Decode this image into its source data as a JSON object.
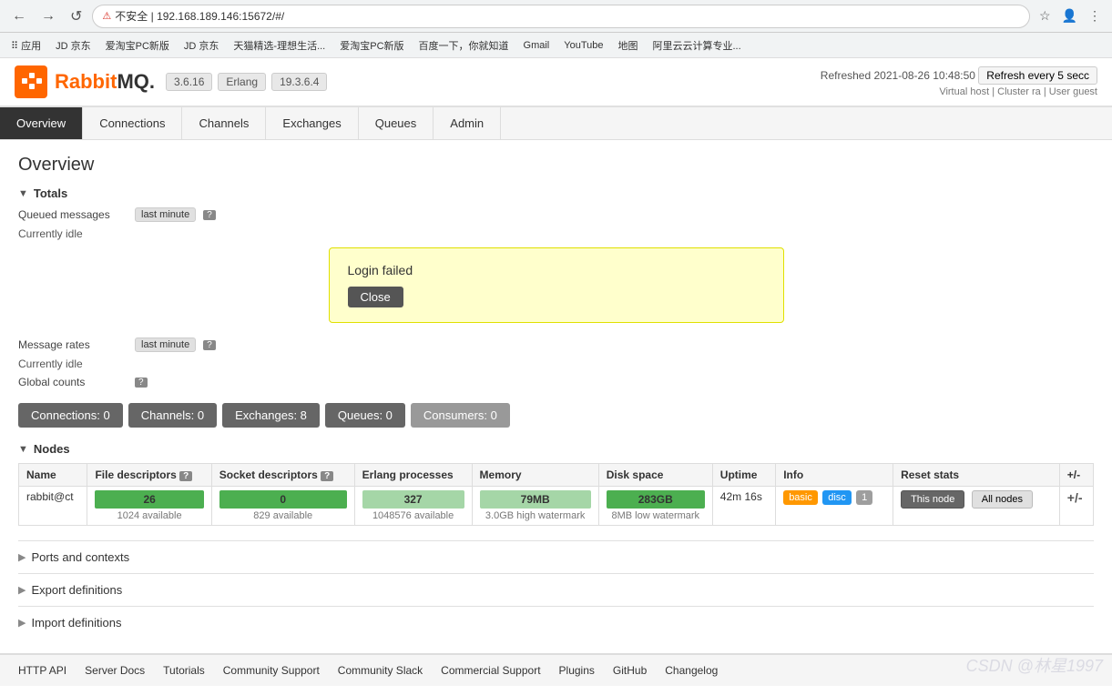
{
  "browser": {
    "back_btn": "←",
    "forward_btn": "→",
    "reload_btn": "↺",
    "address": "192.168.189.146:15672/#/",
    "address_full": "不安全 | 192.168.189.146:15672/#/",
    "lock_icon": "⚠",
    "bookmarks": [
      "应用",
      "JD 京东",
      "爱淘宝PC新版",
      "JD 京东",
      "天猫精选-理想生活...",
      "爱淘宝PC新版",
      "百度一下，你就知道",
      "Gmail",
      "YouTube",
      "地图",
      "阿里云云计算专业..."
    ]
  },
  "rmq": {
    "logo_text": "RabbitMQ",
    "version": "3.6.16",
    "erlang_label": "Erlang",
    "erlang_version": "19.3.6.4",
    "refreshed_label": "Refreshed",
    "refreshed_time": "2021-08-26 10:48:50",
    "refresh_btn_label": "Refresh every 5 secc",
    "virtual_host_label": "Virtual host",
    "cluster_label": "Cluster ra",
    "user_label": "User guest"
  },
  "nav": {
    "items": [
      {
        "id": "overview",
        "label": "Overview",
        "active": true
      },
      {
        "id": "connections",
        "label": "Connections",
        "active": false
      },
      {
        "id": "channels",
        "label": "Channels",
        "active": false
      },
      {
        "id": "exchanges",
        "label": "Exchanges",
        "active": false
      },
      {
        "id": "queues",
        "label": "Queues",
        "active": false
      },
      {
        "id": "admin",
        "label": "Admin",
        "active": false
      }
    ]
  },
  "page": {
    "title": "Overview"
  },
  "totals": {
    "section_title": "Totals",
    "queued_messages_label": "Queued messages",
    "queued_messages_time": "last minute",
    "queued_messages_help": "?",
    "queued_messages_value": "Currently idle",
    "message_rates_label": "Message rates",
    "message_rates_time": "last minute",
    "message_rates_help": "?",
    "message_rates_value": "Currently idle",
    "global_counts_label": "Global counts",
    "global_counts_help": "?"
  },
  "dialog": {
    "title": "Login failed",
    "close_btn": "Close"
  },
  "count_buttons": [
    {
      "label": "Connections: 0",
      "value": 0
    },
    {
      "label": "Channels: 0",
      "value": 0
    },
    {
      "label": "Exchanges: 8",
      "value": 8
    },
    {
      "label": "Queues: 0",
      "value": 0
    },
    {
      "label": "Consumers: 0",
      "value": 0
    }
  ],
  "nodes": {
    "section_title": "Nodes",
    "columns": [
      "Name",
      "File descriptors",
      "Socket descriptors",
      "Erlang processes",
      "Memory",
      "Disk space",
      "Uptime",
      "Info",
      "Reset stats",
      "+/-"
    ],
    "file_desc_help": "?",
    "socket_desc_help": "?",
    "rows": [
      {
        "name": "rabbit@ct",
        "file_desc": "26",
        "file_desc_avail": "1024 available",
        "file_desc_bar_class": "green",
        "socket_desc": "0",
        "socket_desc_avail": "829 available",
        "socket_desc_bar_class": "green",
        "erlang_proc": "327",
        "erlang_proc_avail": "1048576 available",
        "erlang_proc_bar_class": "light-green",
        "memory": "79MB",
        "memory_avail": "3.0GB high watermark",
        "memory_bar_class": "light-green",
        "disk_space": "283GB",
        "disk_space_avail": "8MB low watermark",
        "disk_space_bar_class": "green",
        "uptime": "42m 16s",
        "info_tags": [
          "basic",
          "disc",
          "1"
        ],
        "this_node_btn": "This node",
        "all_nodes_btn": "All nodes"
      }
    ]
  },
  "collapsibles": [
    {
      "id": "ports",
      "label": "Ports and contexts"
    },
    {
      "id": "export",
      "label": "Export definitions"
    },
    {
      "id": "import",
      "label": "Import definitions"
    }
  ],
  "footer": {
    "links": [
      {
        "id": "http-api",
        "label": "HTTP API"
      },
      {
        "id": "server-docs",
        "label": "Server Docs"
      },
      {
        "id": "tutorials",
        "label": "Tutorials"
      },
      {
        "id": "community-support",
        "label": "Community Support"
      },
      {
        "id": "community-slack",
        "label": "Community Slack"
      },
      {
        "id": "commercial-support",
        "label": "Commercial Support"
      },
      {
        "id": "plugins",
        "label": "Plugins"
      },
      {
        "id": "github",
        "label": "GitHub"
      },
      {
        "id": "changelog",
        "label": "Changelog"
      }
    ]
  },
  "watermark": "CSDN @林星1997"
}
